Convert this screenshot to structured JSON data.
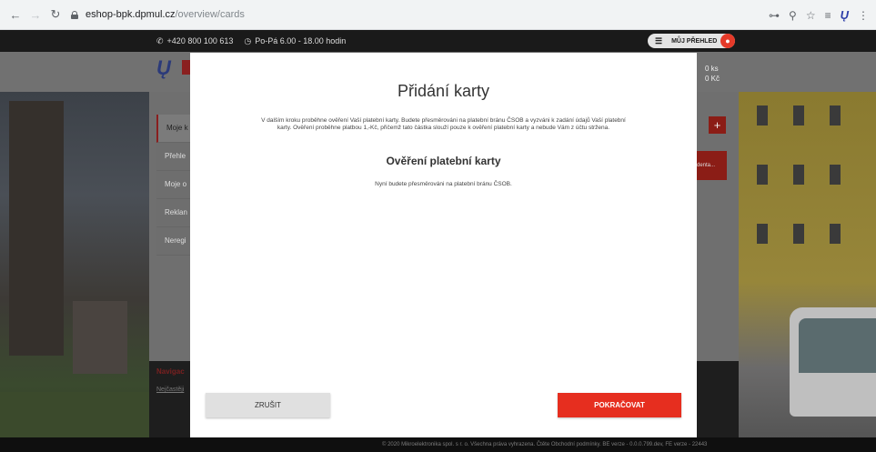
{
  "browser": {
    "url_host": "eshop-bpk.dpmul.cz",
    "url_path": "/overview/cards",
    "back_icon": "arrow-left-icon",
    "forward_icon": "arrow-right-icon",
    "reload_icon": "reload-icon",
    "ext_logo_text": "Ų"
  },
  "topbar": {
    "phone": "+420 800 100 613",
    "hours": "Po-Pá 6.00 - 18.00 hodin",
    "overview_label": "MŮJ PŘEHLED"
  },
  "header": {
    "logo_text": "Ų",
    "cart_count": "0 ks",
    "cart_price": "0 Kč"
  },
  "sidebar": {
    "items": [
      {
        "label": "Moje k"
      },
      {
        "label": "Přehle"
      },
      {
        "label": "Moje o"
      },
      {
        "label": "Reklan"
      },
      {
        "label": "Neregi"
      }
    ]
  },
  "main": {
    "plus_label": "+",
    "red_button_label": "denta..."
  },
  "footer": {
    "nav_heading": "Navigac",
    "link": "Nejčastěji",
    "copyright": "© 2020 Mikroelektronika spol. s r. o. Všechna práva vyhrazena. Čtěte Obchodní podmínky. BE verze - 0.0.0.799.dev, FE verze - 22443"
  },
  "modal": {
    "title": "Přidání karty",
    "intro": "V dalším kroku proběhne ověření Vaší platební karty. Budete přesměrováni na platební bránu ČSOB a vyzváni k zadání údajů Vaší platební karty. Ověření proběhne platbou 1,-Kč, přičemž tato částka slouží pouze k ověření platební karty a nebude Vám z účtu stržena.",
    "subtitle": "Ověření platební karty",
    "redirect_text": "Nyní budete přesměrováni na platební bránu ČSOB.",
    "cancel_label": "ZRUŠIT",
    "continue_label": "POKRAČOVAT"
  }
}
